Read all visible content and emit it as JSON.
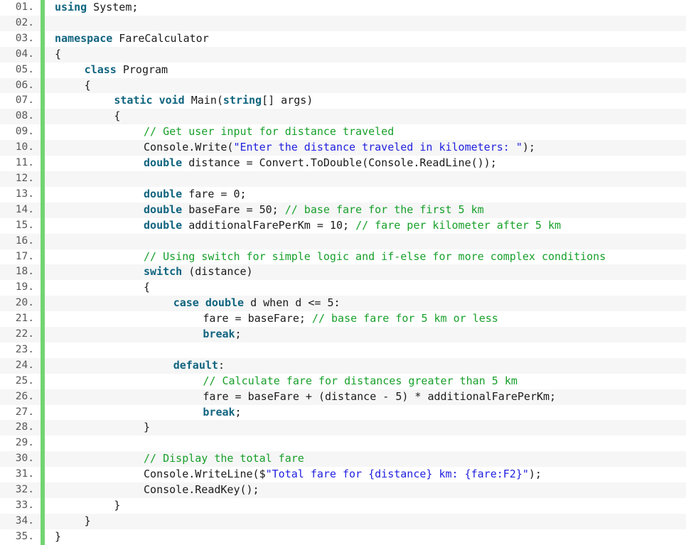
{
  "editor": {
    "language": "csharp",
    "total_lines": 35,
    "gutter_accent_color": "#72d572",
    "gutter_bg_color": "#e8e8e4",
    "alt_row_color": "#f6f6f6",
    "colors": {
      "keyword": "#10647f",
      "comment": "#17a02a",
      "string": "#1f1fe0",
      "plain": "#1a1a1a",
      "line_number": "#585858"
    }
  },
  "lines": [
    {
      "number": "01.",
      "indent": 0,
      "tokens": [
        {
          "t": "kw",
          "v": "using"
        },
        {
          "t": "pln",
          "v": " System;"
        }
      ]
    },
    {
      "number": "02.",
      "indent": 0,
      "tokens": []
    },
    {
      "number": "03.",
      "indent": 0,
      "tokens": [
        {
          "t": "kw",
          "v": "namespace"
        },
        {
          "t": "pln",
          "v": " FareCalculator"
        }
      ]
    },
    {
      "number": "04.",
      "indent": 0,
      "tokens": [
        {
          "t": "pln",
          "v": "{"
        }
      ]
    },
    {
      "number": "05.",
      "indent": 1,
      "tokens": [
        {
          "t": "kw",
          "v": "class"
        },
        {
          "t": "pln",
          "v": " Program"
        }
      ]
    },
    {
      "number": "06.",
      "indent": 1,
      "tokens": [
        {
          "t": "pln",
          "v": "{"
        }
      ]
    },
    {
      "number": "07.",
      "indent": 2,
      "tokens": [
        {
          "t": "kw",
          "v": "static"
        },
        {
          "t": "pln",
          "v": " "
        },
        {
          "t": "kw",
          "v": "void"
        },
        {
          "t": "pln",
          "v": " Main("
        },
        {
          "t": "kw",
          "v": "string"
        },
        {
          "t": "pln",
          "v": "[] args)"
        }
      ]
    },
    {
      "number": "08.",
      "indent": 2,
      "tokens": [
        {
          "t": "pln",
          "v": "{"
        }
      ]
    },
    {
      "number": "09.",
      "indent": 3,
      "tokens": [
        {
          "t": "com",
          "v": "// Get user input for distance traveled"
        }
      ]
    },
    {
      "number": "10.",
      "indent": 3,
      "tokens": [
        {
          "t": "pln",
          "v": "Console.Write("
        },
        {
          "t": "str",
          "v": "\"Enter the distance traveled in kilometers: \""
        },
        {
          "t": "pln",
          "v": ");"
        }
      ]
    },
    {
      "number": "11.",
      "indent": 3,
      "tokens": [
        {
          "t": "kw",
          "v": "double"
        },
        {
          "t": "pln",
          "v": " distance = Convert.ToDouble(Console.ReadLine());"
        }
      ]
    },
    {
      "number": "12.",
      "indent": 0,
      "tokens": []
    },
    {
      "number": "13.",
      "indent": 3,
      "tokens": [
        {
          "t": "kw",
          "v": "double"
        },
        {
          "t": "pln",
          "v": " fare = 0;"
        }
      ]
    },
    {
      "number": "14.",
      "indent": 3,
      "tokens": [
        {
          "t": "kw",
          "v": "double"
        },
        {
          "t": "pln",
          "v": " baseFare = 50; "
        },
        {
          "t": "com",
          "v": "// base fare for the first 5 km"
        }
      ]
    },
    {
      "number": "15.",
      "indent": 3,
      "tokens": [
        {
          "t": "kw",
          "v": "double"
        },
        {
          "t": "pln",
          "v": " additionalFarePerKm = 10; "
        },
        {
          "t": "com",
          "v": "// fare per kilometer after 5 km"
        }
      ]
    },
    {
      "number": "16.",
      "indent": 0,
      "tokens": []
    },
    {
      "number": "17.",
      "indent": 3,
      "tokens": [
        {
          "t": "com",
          "v": "// Using switch for simple logic and if-else for more complex conditions"
        }
      ]
    },
    {
      "number": "18.",
      "indent": 3,
      "tokens": [
        {
          "t": "kw",
          "v": "switch"
        },
        {
          "t": "pln",
          "v": " (distance)"
        }
      ]
    },
    {
      "number": "19.",
      "indent": 3,
      "tokens": [
        {
          "t": "pln",
          "v": "{"
        }
      ]
    },
    {
      "number": "20.",
      "indent": 4,
      "tokens": [
        {
          "t": "kw",
          "v": "case"
        },
        {
          "t": "pln",
          "v": " "
        },
        {
          "t": "kw",
          "v": "double"
        },
        {
          "t": "pln",
          "v": " d when d <= 5:"
        }
      ]
    },
    {
      "number": "21.",
      "indent": 5,
      "tokens": [
        {
          "t": "pln",
          "v": "fare = baseFare; "
        },
        {
          "t": "com",
          "v": "// base fare for 5 km or less"
        }
      ]
    },
    {
      "number": "22.",
      "indent": 5,
      "tokens": [
        {
          "t": "kw",
          "v": "break"
        },
        {
          "t": "pln",
          "v": ";"
        }
      ]
    },
    {
      "number": "23.",
      "indent": 0,
      "tokens": []
    },
    {
      "number": "24.",
      "indent": 4,
      "tokens": [
        {
          "t": "kw",
          "v": "default"
        },
        {
          "t": "pln",
          "v": ":"
        }
      ]
    },
    {
      "number": "25.",
      "indent": 5,
      "tokens": [
        {
          "t": "com",
          "v": "// Calculate fare for distances greater than 5 km"
        }
      ]
    },
    {
      "number": "26.",
      "indent": 5,
      "tokens": [
        {
          "t": "pln",
          "v": "fare = baseFare + (distance - 5) * additionalFarePerKm;"
        }
      ]
    },
    {
      "number": "27.",
      "indent": 5,
      "tokens": [
        {
          "t": "kw",
          "v": "break"
        },
        {
          "t": "pln",
          "v": ";"
        }
      ]
    },
    {
      "number": "28.",
      "indent": 3,
      "tokens": [
        {
          "t": "pln",
          "v": "}"
        }
      ]
    },
    {
      "number": "29.",
      "indent": 0,
      "tokens": []
    },
    {
      "number": "30.",
      "indent": 3,
      "tokens": [
        {
          "t": "com",
          "v": "// Display the total fare"
        }
      ]
    },
    {
      "number": "31.",
      "indent": 3,
      "tokens": [
        {
          "t": "pln",
          "v": "Console.WriteLine($"
        },
        {
          "t": "str",
          "v": "\"Total fare for {distance} km: {fare:F2}\""
        },
        {
          "t": "pln",
          "v": ");"
        }
      ]
    },
    {
      "number": "32.",
      "indent": 3,
      "tokens": [
        {
          "t": "pln",
          "v": "Console.ReadKey();"
        }
      ]
    },
    {
      "number": "33.",
      "indent": 2,
      "tokens": [
        {
          "t": "pln",
          "v": "}"
        }
      ]
    },
    {
      "number": "34.",
      "indent": 1,
      "tokens": [
        {
          "t": "pln",
          "v": "}"
        }
      ]
    },
    {
      "number": "35.",
      "indent": 0,
      "tokens": [
        {
          "t": "pln",
          "v": "}"
        }
      ]
    }
  ]
}
